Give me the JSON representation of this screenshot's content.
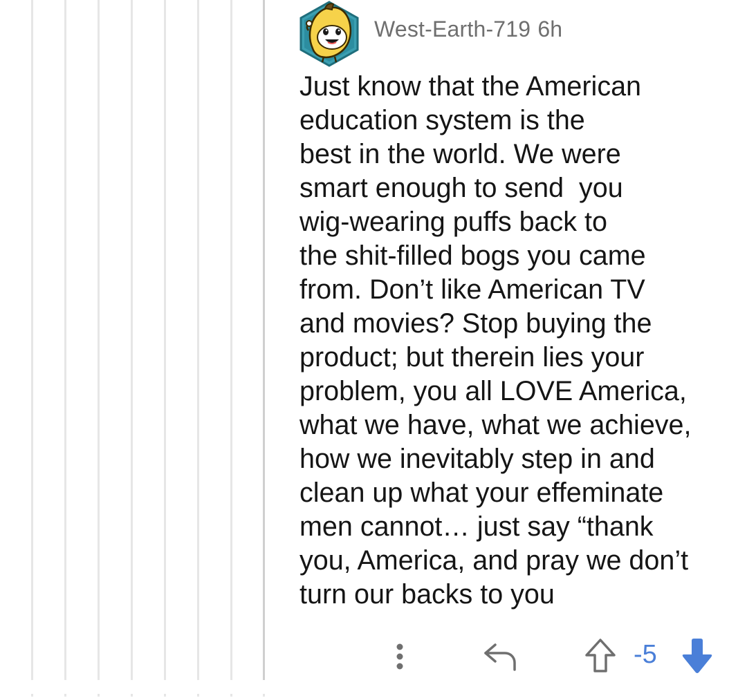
{
  "comment": {
    "author": "West-Earth-719",
    "age": "6h",
    "avatar_icon": "banana-snoo-avatar-icon",
    "body_lines": [
      "Just know that the American",
      "education system is the",
      "best in the world. We were",
      "smart enough to send  you",
      "wig-wearing puffs back to",
      "the shit-filled bogs you came",
      "from. Don’t like American TV",
      "and movies? Stop buying the",
      "product; but therein lies your",
      "problem, you all LOVE America,",
      "what we have, what we achieve,",
      "how we inevitably step in and",
      "clean up what your effeminate",
      "men cannot… just say “thank",
      "you, America, and pray we don’t",
      "turn our backs to you"
    ]
  },
  "actions": {
    "more_icon": "more-vertical-icon",
    "reply_icon": "reply-arrow-icon",
    "upvote_icon": "upvote-arrow-icon",
    "score": "-5",
    "downvote_icon": "downvote-arrow-icon"
  },
  "colors": {
    "author_text": "#6f6f6f",
    "body_text": "#151515",
    "score": "#4a7fd8",
    "downvote_active": "#4a7fd8",
    "icon_gray": "#6f6f6f",
    "thread_line": "#e6e6e6"
  }
}
